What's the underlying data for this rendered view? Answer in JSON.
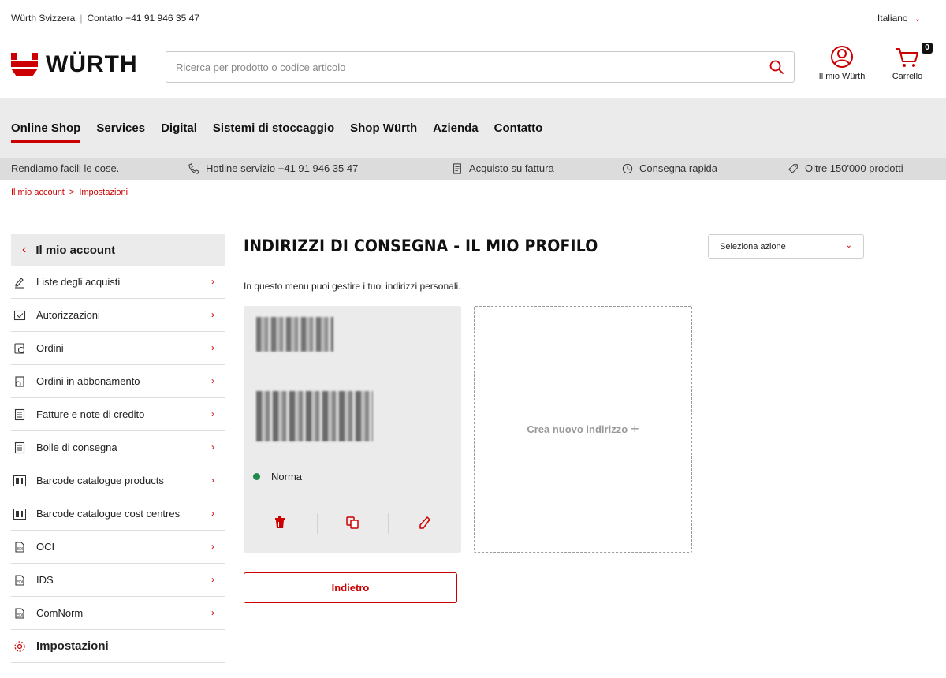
{
  "topbar": {
    "company": "Würth Svizzera",
    "contact": "Contatto +41 91 946 35 47",
    "language": "Italiano"
  },
  "header": {
    "logo_text": "WÜRTH",
    "search_placeholder": "Ricerca per prodotto o codice articolo",
    "account_label": "Il mio Würth",
    "cart_label": "Carrello",
    "cart_count": "0"
  },
  "mainnav": {
    "items": [
      {
        "label": "Online Shop"
      },
      {
        "label": "Services"
      },
      {
        "label": "Digital"
      },
      {
        "label": "Sistemi di stoccaggio"
      },
      {
        "label": "Shop Würth"
      },
      {
        "label": "Azienda"
      },
      {
        "label": "Contatto"
      }
    ]
  },
  "usp": {
    "tagline": "Rendiamo facili le cose.",
    "hotline": "Hotline servizio +41 91 946 35 47",
    "invoice": "Acquisto su fattura",
    "delivery": "Consegna rapida",
    "products": "Oltre 150'000 prodotti"
  },
  "breadcrumb": {
    "items": [
      "Il mio account",
      "Impostazioni"
    ],
    "separator": ">"
  },
  "sidebar": {
    "back_label": "Il mio account",
    "items": [
      {
        "label": "Liste degli acquisti",
        "icon": "pencil-list-icon"
      },
      {
        "label": "Autorizzazioni",
        "icon": "approval-icon"
      },
      {
        "label": "Ordini",
        "icon": "orders-icon"
      },
      {
        "label": "Ordini in abbonamento",
        "icon": "subscription-icon"
      },
      {
        "label": "Fatture e note di credito",
        "icon": "invoice-icon"
      },
      {
        "label": "Bolle di consegna",
        "icon": "delivery-note-icon"
      },
      {
        "label": "Barcode catalogue products",
        "icon": "barcode-icon"
      },
      {
        "label": "Barcode catalogue cost centres",
        "icon": "barcode-icon"
      },
      {
        "label": "OCI",
        "icon": "edi-icon"
      },
      {
        "label": "IDS",
        "icon": "edi-icon"
      },
      {
        "label": "ComNorm",
        "icon": "edi-icon"
      }
    ],
    "settings_label": "Impostazioni"
  },
  "content": {
    "title": "INDIRIZZI DI CONSEGNA - IL MIO PROFILO",
    "action_select": "Seleziona azione",
    "intro": "In questo menu puoi gestire i tuoi indirizzi personali.",
    "address_status": "Norma",
    "new_address_label": "Crea nuovo indirizzo",
    "back_button": "Indietro"
  },
  "colors": {
    "brand_red": "#cc0000",
    "status_green": "#1f8a4c",
    "nav_bg": "#ebebeb",
    "usp_bg": "#dcdcdc"
  }
}
